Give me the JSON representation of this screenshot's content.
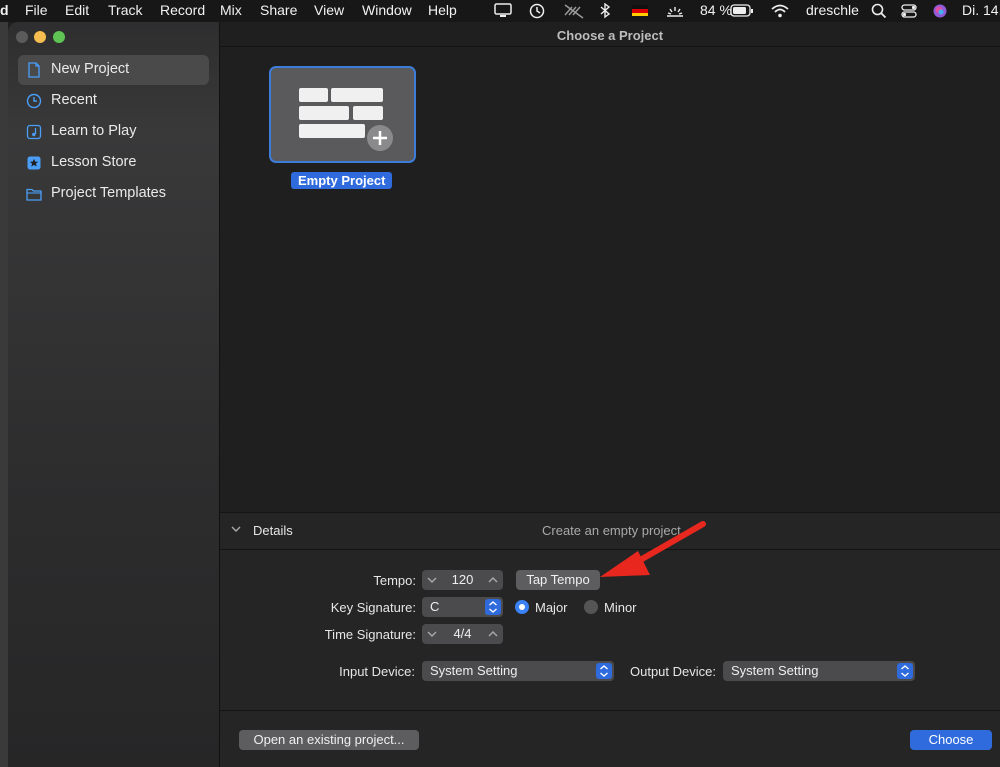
{
  "menubar": {
    "app_glyph": "d",
    "items": [
      "File",
      "Edit",
      "Track",
      "Record",
      "Mix",
      "Share",
      "View",
      "Window",
      "Help"
    ],
    "battery": "84 %",
    "user": "dreschle",
    "clock": "Di. 14."
  },
  "window": {
    "title": "Choose a Project"
  },
  "sidebar": {
    "items": [
      {
        "label": "New Project",
        "icon": "document-icon",
        "selected": true
      },
      {
        "label": "Recent",
        "icon": "clock-icon",
        "selected": false
      },
      {
        "label": "Learn to Play",
        "icon": "music-note-icon",
        "selected": false
      },
      {
        "label": "Lesson Store",
        "icon": "star-icon",
        "selected": false
      },
      {
        "label": "Project Templates",
        "icon": "folder-icon",
        "selected": false
      }
    ]
  },
  "templates": [
    {
      "label": "Empty Project",
      "icon": "empty-project-tracks-icon",
      "selected": true
    }
  ],
  "details": {
    "title": "Details",
    "description": "Create an empty project.",
    "tempo_label": "Tempo:",
    "tempo_value": "120",
    "tap_tempo_label": "Tap Tempo",
    "key_signature_label": "Key Signature:",
    "key_signature_value": "C",
    "mode_major_label": "Major",
    "mode_minor_label": "Minor",
    "mode_selected": "Major",
    "time_signature_label": "Time Signature:",
    "time_signature_value": "4/4",
    "input_device_label": "Input Device:",
    "input_device_value": "System Setting",
    "output_device_label": "Output Device:",
    "output_device_value": "System Setting"
  },
  "footer": {
    "open_existing_label": "Open an existing project...",
    "choose_label": "Choose"
  },
  "colors": {
    "accent": "#2f6bdc",
    "annotation_arrow": "#e8281e"
  }
}
